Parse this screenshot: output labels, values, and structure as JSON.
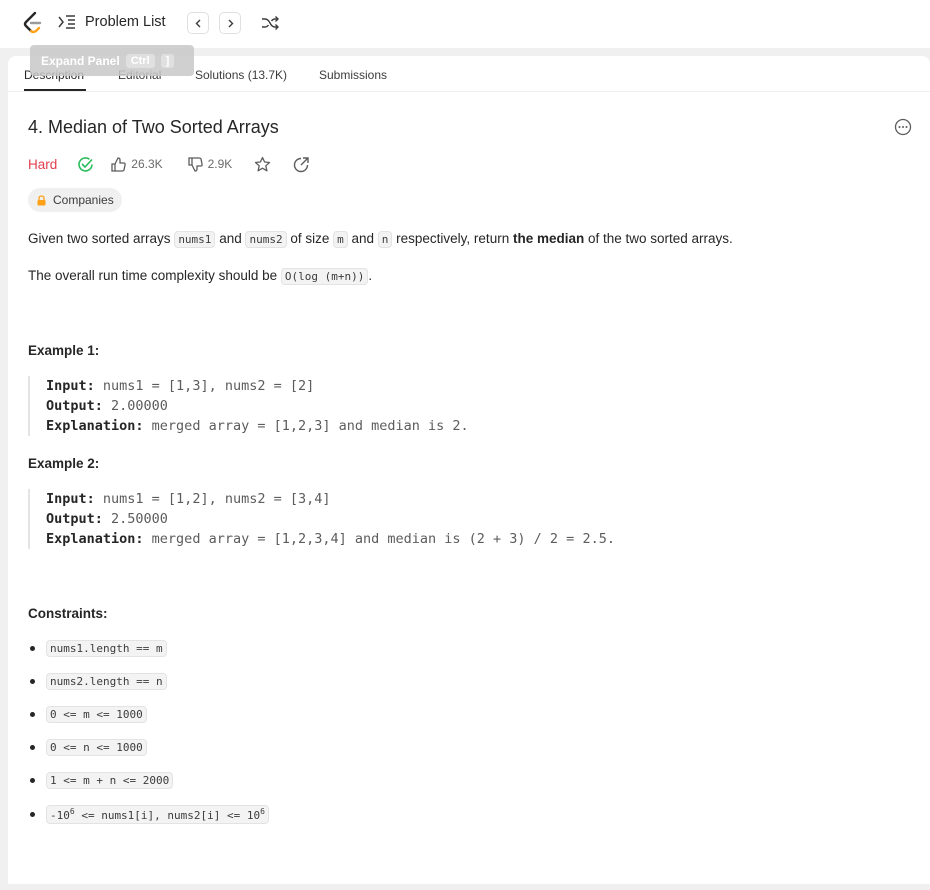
{
  "topbar": {
    "problem_list_label": "Problem List"
  },
  "tooltip": {
    "label": "Expand Panel",
    "shortcut_key1": "Ctrl",
    "shortcut_key2": "]"
  },
  "tabs": [
    {
      "label": "Description",
      "active": true
    },
    {
      "label": "Editorial"
    },
    {
      "label": "Solutions (13.7K)"
    },
    {
      "label": "Submissions"
    }
  ],
  "problem": {
    "title": "4. Median of Two Sorted Arrays",
    "difficulty": "Hard",
    "likes": "26.3K",
    "dislikes": "2.9K",
    "companies_label": "Companies"
  },
  "description": {
    "p1": {
      "t1": "Given two sorted arrays ",
      "c1": "nums1",
      "t2": " and ",
      "c2": "nums2",
      "t3": " of size ",
      "c3": "m",
      "t4": " and ",
      "c4": "n",
      "t5": " respectively, return ",
      "bold": "the median",
      "t6": " of the two sorted arrays."
    },
    "p2": {
      "t1": "The overall run time complexity should be ",
      "c1": "O(log (m+n))",
      "t2": "."
    }
  },
  "examples": [
    {
      "heading": "Example 1:",
      "input_label": "Input:",
      "input": " nums1 = [1,3], nums2 = [2]",
      "output_label": "Output:",
      "output": " 2.00000",
      "explanation_label": "Explanation:",
      "explanation": " merged array = [1,2,3] and median is 2."
    },
    {
      "heading": "Example 2:",
      "input_label": "Input:",
      "input": " nums1 = [1,2], nums2 = [3,4]",
      "output_label": "Output:",
      "output": " 2.50000",
      "explanation_label": "Explanation:",
      "explanation": " merged array = [1,2,3,4] and median is (2 + 3) / 2 = 2.5."
    }
  ],
  "constraints": {
    "heading": "Constraints:",
    "items": [
      "nums1.length == m",
      "nums2.length == n",
      "0 <= m <= 1000",
      "0 <= n <= 1000",
      "1 <= m + n <= 2000"
    ],
    "last": {
      "t1": "-10",
      "sup1": "6",
      "t2": " <= nums1[i], nums2[i] <= 10",
      "sup2": "6"
    }
  },
  "colors": {
    "hard": "#e0404f",
    "solved_check": "#2cbb5d",
    "lock": "#ffa116"
  }
}
